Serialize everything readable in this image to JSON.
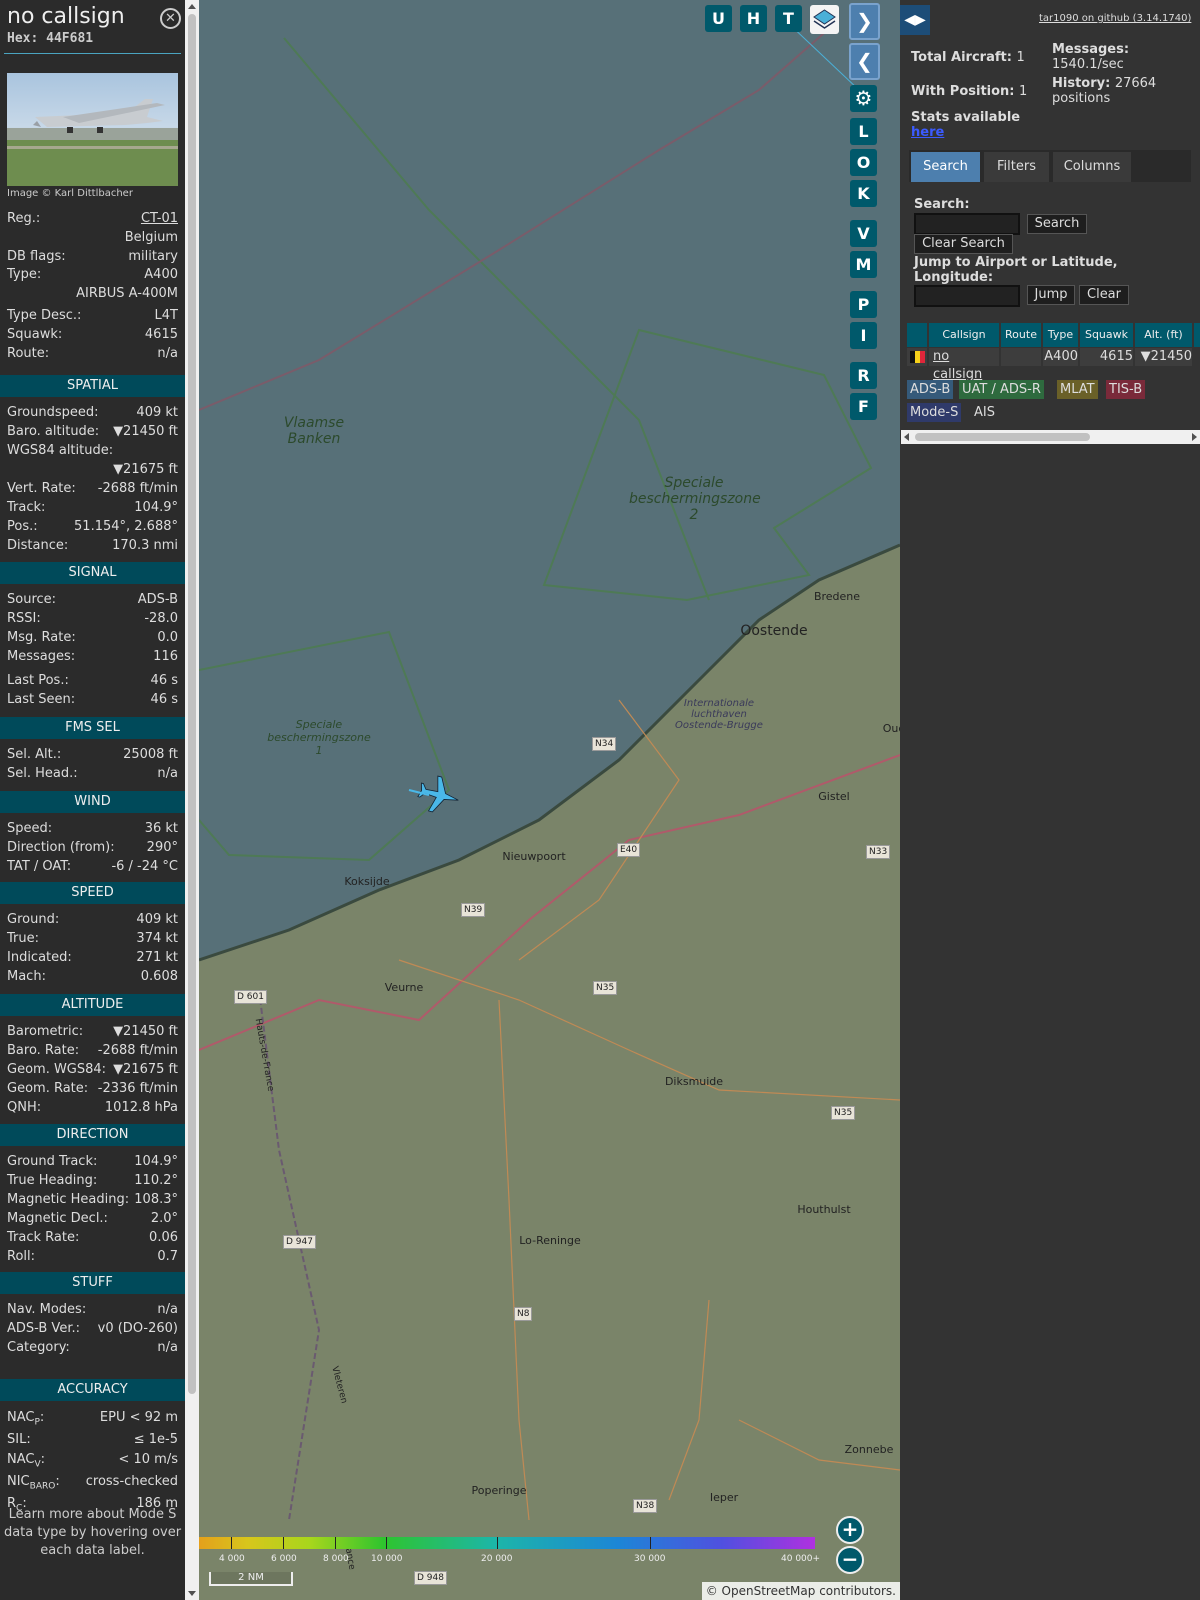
{
  "infoblock": {
    "callsign": "no callsign",
    "hex_label": "Hex:",
    "hex": "44F681",
    "image_credit": "Image © Karl Dittlbacher",
    "header_rows": [
      {
        "label": "Reg.:",
        "value": "CT-01"
      },
      {
        "label": "",
        "value": "Belgium"
      },
      {
        "label": "DB flags:",
        "value": "military"
      },
      {
        "label": "Type:",
        "value": "A400"
      },
      {
        "label": "",
        "value": "AIRBUS A-400M"
      },
      {
        "label": "Type Desc.:",
        "value": "L4T"
      },
      {
        "label": "Squawk:",
        "value": "4615"
      },
      {
        "label": "Route:",
        "value": "n/a"
      }
    ],
    "sections": [
      {
        "title": "SPATIAL",
        "rows": [
          {
            "label": "Groundspeed:",
            "value": "409 kt"
          },
          {
            "label": "Baro. altitude:",
            "value": "▼21450 ft"
          },
          {
            "label": "WGS84 altitude:",
            "value": ""
          },
          {
            "label": "",
            "value": "▼21675 ft"
          },
          {
            "label": "Vert. Rate:",
            "value": "-2688 ft/min"
          },
          {
            "label": "Track:",
            "value": "104.9°"
          },
          {
            "label": "Pos.:",
            "value": "51.154°, 2.688°"
          },
          {
            "label": "Distance:",
            "value": "170.3 nmi"
          }
        ]
      },
      {
        "title": "SIGNAL",
        "rows": [
          {
            "label": "Source:",
            "value": "ADS-B"
          },
          {
            "label": "RSSI:",
            "value": "-28.0"
          },
          {
            "label": "Msg. Rate:",
            "value": "0.0"
          },
          {
            "label": "Messages:",
            "value": "116"
          },
          {
            "label": "Last Pos.:",
            "value": "46 s"
          },
          {
            "label": "Last Seen:",
            "value": "46 s"
          }
        ]
      },
      {
        "title": "FMS SEL",
        "rows": [
          {
            "label": "Sel. Alt.:",
            "value": "25008 ft"
          },
          {
            "label": "Sel. Head.:",
            "value": "n/a"
          }
        ]
      },
      {
        "title": "WIND",
        "rows": [
          {
            "label": "Speed:",
            "value": "36 kt"
          },
          {
            "label": "Direction (from):",
            "value": "290°"
          },
          {
            "label": "TAT / OAT:",
            "value": "-6 / -24 °C"
          }
        ]
      },
      {
        "title": "SPEED",
        "rows": [
          {
            "label": "Ground:",
            "value": "409 kt"
          },
          {
            "label": "True:",
            "value": "374 kt"
          },
          {
            "label": "Indicated:",
            "value": "271 kt"
          },
          {
            "label": "Mach:",
            "value": "0.608"
          }
        ]
      },
      {
        "title": "ALTITUDE",
        "rows": [
          {
            "label": "Barometric:",
            "value": "▼21450 ft"
          },
          {
            "label": "Baro. Rate:",
            "value": "-2688 ft/min"
          },
          {
            "label": "Geom. WGS84:",
            "value": "▼21675 ft"
          },
          {
            "label": "Geom. Rate:",
            "value": "-2336 ft/min"
          },
          {
            "label": "QNH:",
            "value": "1012.8 hPa"
          }
        ]
      },
      {
        "title": "DIRECTION",
        "rows": [
          {
            "label": "Ground Track:",
            "value": "104.9°"
          },
          {
            "label": "True Heading:",
            "value": "110.2°"
          },
          {
            "label": "Magnetic Heading:",
            "value": "108.3°"
          },
          {
            "label": "Magnetic Decl.:",
            "value": "2.0°"
          },
          {
            "label": "Track Rate:",
            "value": "0.06"
          },
          {
            "label": "Roll:",
            "value": "0.7"
          }
        ]
      },
      {
        "title": "STUFF",
        "rows": [
          {
            "label": "Nav. Modes:",
            "value": "n/a"
          },
          {
            "label": "ADS-B Ver.:",
            "value": "v0 (DO-260)"
          },
          {
            "label": "Category:",
            "value": "n/a"
          }
        ]
      }
    ],
    "accuracy": {
      "title": "ACCURACY",
      "nacp_label": "NAC",
      "nacp_sub": "P",
      "nacp_value": "EPU < 92 m",
      "sil_label": "SIL:",
      "sil_value": "≤ 1e-5",
      "nacv_label": "NAC",
      "nacv_sub": "V",
      "nacv_value": "< 10 m/s",
      "nicbaro_label": "NIC",
      "nicbaro_sub": "BARO",
      "nicbaro_value": "cross-checked",
      "rc_label": "R",
      "rc_sub": "C",
      "rc_value": "186 m",
      "colon": ":"
    },
    "note": "Learn more about Mode S data type by hovering over each data label."
  },
  "map": {
    "top_buttons": [
      "U",
      "H",
      "T"
    ],
    "side_buttons": [
      "L",
      "O",
      "K",
      "V",
      "M",
      "P",
      "I",
      "R",
      "F"
    ],
    "labels": {
      "vlaamse": "Vlaamse Banken",
      "zone2": "Speciale beschermingszone 2",
      "zone1": "Speciale beschermingszone 1",
      "oostende": "Oostende",
      "bredene": "Bredene",
      "airport": "Internationale luchthaven Oostende-Brugge",
      "oud": "Oud",
      "gistel": "Gistel",
      "nieuwpoort": "Nieuwpoort",
      "koksijde": "Koksijde",
      "veurne": "Veurne",
      "diksmuide": "Diksmuide",
      "houthulst": "Houthulst",
      "loreninge": "Lo-Reninge",
      "poperinge": "Poperinge",
      "ieper": "Ieper",
      "zonnebe": "Zonnebe",
      "hauts": "Hauts-de-France",
      "vleteren": "Vleteren",
      "france": "France"
    },
    "roads": [
      "N34",
      "E40",
      "N33",
      "N39",
      "N35",
      "D 601",
      "N35",
      "D 947",
      "N8",
      "N38",
      "D 948"
    ],
    "legend_ticks": [
      "4 000",
      "6 000",
      "8 000",
      "10 000",
      "20 000",
      "30 000",
      "40 000+"
    ],
    "scale_label": "2 NM",
    "attribution_prefix": "© ",
    "attribution_link": "OpenStreetMap",
    "attribution_suffix": " contributors."
  },
  "sidebar": {
    "github_link": "tar1090 on github (3.14.1740)",
    "total_aircraft_label": "Total Aircraft:",
    "total_aircraft": "1",
    "with_position_label": "With Position:",
    "with_position": "1",
    "messages_label": "Messages:",
    "messages": "1540.1/sec",
    "history_label": "History:",
    "history_value": "27664",
    "history_unit": "positions",
    "stats_text": "Stats available",
    "stats_link": "here",
    "tabs": [
      "Search",
      "Filters",
      "Columns"
    ],
    "search_label": "Search:",
    "search_button": "Search",
    "clear_search_button": "Clear Search",
    "jump_label": "Jump to Airport or Latitude, Longitude:",
    "jump_button": "Jump",
    "clear_button": "Clear",
    "table_headers": [
      "Callsign",
      "Route",
      "Type",
      "Squawk",
      "Alt. (ft)"
    ],
    "table_rows": [
      {
        "callsign": "no callsign",
        "route": "",
        "type": "A400",
        "squawk": "4615",
        "alt": "▼21450"
      }
    ],
    "sources": [
      "ADS-B",
      "UAT / ADS-R",
      "MLAT",
      "TIS-B",
      "Mode-S",
      "AIS"
    ]
  },
  "colors": {
    "accent": "#00596b",
    "tab_active": "#4d7fae",
    "sea": "#577078",
    "land": "#7a8469"
  }
}
